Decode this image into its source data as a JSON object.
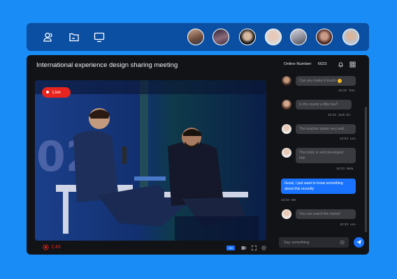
{
  "toolbar": {
    "icons": [
      "users-icon",
      "folder-icon",
      "screen-share-icon"
    ],
    "participants": [
      "participant-1",
      "participant-2",
      "participant-3",
      "participant-4",
      "participant-5",
      "participant-6",
      "participant-7"
    ]
  },
  "meeting": {
    "title": "International experience design sharing meeting",
    "online_label": "Online Number:",
    "online_count": "6023"
  },
  "video": {
    "live_label": "Live",
    "timer": "1:43",
    "hd_label": "HD"
  },
  "chat": {
    "messages": [
      {
        "text": "Can you make it louder ",
        "time": "10:32",
        "user": "Tom"
      },
      {
        "text": "Is the sound a little low?",
        "time": "10:32",
        "user": "Jack Jin"
      },
      {
        "text": "The teacher spoke very well",
        "time": "10:33",
        "user": "Leo"
      },
      {
        "text": "This topic is well developed ",
        "text2": "hhh",
        "time": "10:33",
        "user": "Bela"
      },
      {
        "text": "Good, I just want to know something ",
        "text2": "about this recently",
        "time": "10:33",
        "user": "Me"
      },
      {
        "text": "You can watch the replay!",
        "time": "10:33",
        "user": "Leo"
      }
    ],
    "placeholder": "Say something"
  },
  "colors": {
    "accent": "#1a73ff",
    "background": "#1a8cf5",
    "live": "#e8241f",
    "panel": "#121316"
  }
}
